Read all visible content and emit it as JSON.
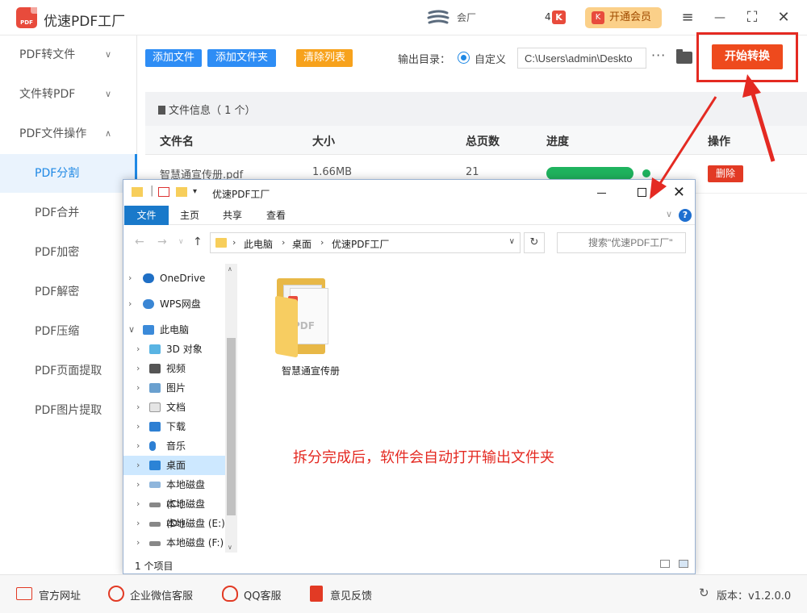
{
  "app": {
    "title": "优速PDF工厂",
    "brand_text": "会厂",
    "notif_count": "4",
    "notif_icon_letter": "K",
    "vip_label": "开通会员",
    "vip_icon_letter": "K"
  },
  "window_controls": {
    "menu": "≡",
    "minimize": "—",
    "maximize": "⛶",
    "close": "✕"
  },
  "sidebar": {
    "groups": [
      {
        "label": "PDF转文件",
        "chevron": "∨"
      },
      {
        "label": "文件转PDF",
        "chevron": "∨"
      },
      {
        "label": "PDF文件操作",
        "chevron": "∧"
      }
    ],
    "subitems": [
      {
        "label": "PDF分割",
        "active": true
      },
      {
        "label": "PDF合并"
      },
      {
        "label": "PDF加密"
      },
      {
        "label": "PDF解密"
      },
      {
        "label": "PDF压缩"
      },
      {
        "label": "PDF页面提取"
      },
      {
        "label": "PDF图片提取"
      }
    ]
  },
  "toolbar": {
    "add_file": "添加文件",
    "add_folder": "添加文件夹",
    "clear_list": "清除列表",
    "output_label": "输出目录：",
    "output_option": "自定义",
    "output_path": "C:\\Users\\admin\\Deskto",
    "more": "···",
    "start_button": "开始转换"
  },
  "file_panel": {
    "header": "文件信息（ 1 个）",
    "columns": [
      "文件名",
      "大小",
      "总页数",
      "进度",
      "操作"
    ],
    "rows": [
      {
        "name": "智慧通宣传册.pdf",
        "size": "1.66MB",
        "pages": "21",
        "progress": 1.0,
        "action": "删除"
      }
    ]
  },
  "explorer": {
    "title": "优速PDF工厂",
    "ribbon_tabs": [
      "文件",
      "主页",
      "共享",
      "查看"
    ],
    "help": "?",
    "breadcrumb": [
      "此电脑",
      "桌面",
      "优速PDF工厂"
    ],
    "refresh": "↻",
    "search_placeholder": "搜索\"优速PDF工厂\"",
    "tree": [
      {
        "label": "OneDrive",
        "icon": "cloud-icon"
      },
      {
        "label": "WPS网盘",
        "icon": "cloud-icon"
      },
      {
        "label": "此电脑",
        "icon": "computer-icon",
        "expanded": true
      },
      {
        "label": "3D 对象",
        "icon": "cube-icon"
      },
      {
        "label": "视频",
        "icon": "video-icon"
      },
      {
        "label": "图片",
        "icon": "picture-icon"
      },
      {
        "label": "文档",
        "icon": "document-icon"
      },
      {
        "label": "下载",
        "icon": "download-icon"
      },
      {
        "label": "音乐",
        "icon": "music-icon"
      },
      {
        "label": "桌面",
        "icon": "desktop-icon",
        "selected": true
      },
      {
        "label": "本地磁盘 (C:)",
        "icon": "drive-icon"
      },
      {
        "label": "本地磁盘 (D:)",
        "icon": "drive-icon"
      },
      {
        "label": "本地磁盘 (E:)",
        "icon": "drive-icon"
      },
      {
        "label": "本地磁盘 (F:)",
        "icon": "drive-icon"
      }
    ],
    "folder_item": "智慧通宣传册",
    "annotation": "拆分完成后，软件会自动打开输出文件夹",
    "status_count": "1 个项目"
  },
  "footer": {
    "items": [
      {
        "label": "官方网址",
        "icon": "website-icon"
      },
      {
        "label": "企业微信客服",
        "icon": "wechat-icon"
      },
      {
        "label": "QQ客服",
        "icon": "qq-icon"
      },
      {
        "label": "意见反馈",
        "icon": "feedback-icon"
      }
    ],
    "version": "版本：v1.2.0.0"
  },
  "colors": {
    "primary": "#2e8df5",
    "start": "#ee4a1d",
    "annotation": "#e42a22",
    "progress": "#1fb35e"
  }
}
